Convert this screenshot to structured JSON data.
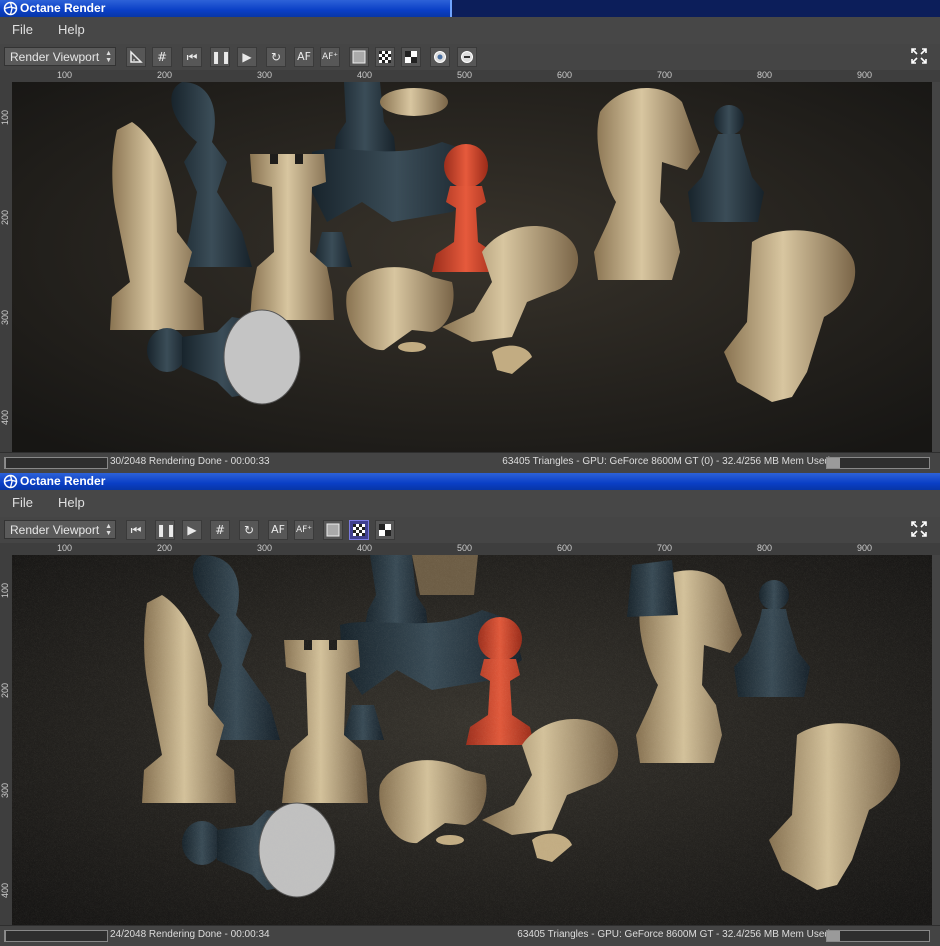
{
  "windows": [
    {
      "title": "Octane Render",
      "menu": [
        "File",
        "Help"
      ],
      "viewport_select": "Render Viewport",
      "toolbar": [
        "clear-render-icon",
        "grid-icon",
        "restart-icon",
        "pause-icon",
        "play-icon",
        "refresh-icon",
        "AF",
        "af-picker-icon",
        "alpha-mode-1-icon",
        "alpha-mode-2-icon",
        "alpha-mode-3-icon",
        "zoom-in-icon",
        "zoom-out-icon"
      ],
      "ruler_x": [
        "100",
        "200",
        "300",
        "400",
        "500",
        "600",
        "700",
        "800",
        "900"
      ],
      "ruler_y": [
        "100",
        "200",
        "300",
        "400"
      ],
      "progress": 0.0146,
      "status_left": "30/2048 Rendering Done - 00:00:33",
      "status_right": "63405 Triangles - GPU: GeForce 8600M GT (0) - 32.4/256 MB Mem Used",
      "mem_fraction": 0.127
    },
    {
      "title": "Octane Render",
      "menu": [
        "File",
        "Help"
      ],
      "viewport_select": "Render Viewport",
      "toolbar": [
        "restart-icon",
        "pause-icon",
        "play-icon",
        "grid-icon",
        "refresh-icon",
        "AF",
        "af-picker-icon",
        "alpha-mode-1-icon",
        "alpha-mode-2-icon",
        "alpha-mode-3-icon"
      ],
      "active_tool": "alpha-mode-2-icon",
      "ruler_x": [
        "100",
        "200",
        "300",
        "400",
        "500",
        "600",
        "700",
        "800",
        "900"
      ],
      "ruler_y": [
        "100",
        "200",
        "300",
        "400"
      ],
      "progress": 0.0117,
      "status_left": "24/2048 Rendering Done - 00:00:34",
      "status_right": "63405 Triangles - GPU: GeForce 8600M GT - 32.4/256 MB Mem Used",
      "mem_fraction": 0.127
    }
  ],
  "colors": {
    "titlebar": "#0a3fc6",
    "chrome": "#444444",
    "render_bg": "#1e1d1b",
    "wood_light": "#d2bf98",
    "slate_dark": "#2b3a44",
    "red_pawn": "#d24a30"
  }
}
